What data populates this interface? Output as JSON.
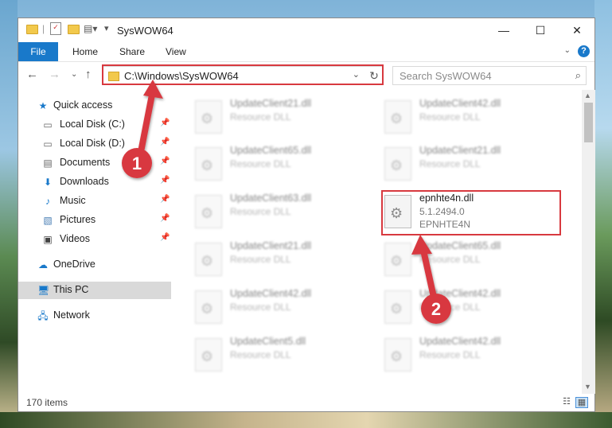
{
  "window": {
    "title": "SysWOW64",
    "controls": {
      "minimize": "—",
      "maximize": "☐",
      "close": "✕"
    }
  },
  "ribbon": {
    "tabs": [
      "File",
      "Home",
      "Share",
      "View"
    ],
    "help": "?"
  },
  "address": {
    "path": "C:\\Windows\\SysWOW64",
    "search_placeholder": "Search SysWOW64"
  },
  "sidebar": {
    "items": [
      {
        "label": "Quick access",
        "icon": "star-icon"
      },
      {
        "label": "Local Disk (C:)",
        "icon": "drive-icon",
        "pinned": true
      },
      {
        "label": "Local Disk (D:)",
        "icon": "drive-icon",
        "pinned": true
      },
      {
        "label": "Documents",
        "icon": "documents-icon",
        "pinned": true
      },
      {
        "label": "Downloads",
        "icon": "download-icon",
        "pinned": true
      },
      {
        "label": "Music",
        "icon": "music-icon",
        "pinned": true
      },
      {
        "label": "Pictures",
        "icon": "pictures-icon",
        "pinned": true
      },
      {
        "label": "Videos",
        "icon": "videos-icon",
        "pinned": true
      },
      {
        "label": "OneDrive",
        "icon": "cloud-icon"
      },
      {
        "label": "This PC",
        "icon": "computer-icon",
        "selected": true
      },
      {
        "label": "Network",
        "icon": "network-icon"
      }
    ]
  },
  "files": [
    {
      "name": "UpdateClient21.dll",
      "type": "Resource DLL"
    },
    {
      "name": "UpdateClient42.dll",
      "type": "Resource DLL"
    },
    {
      "name": "UpdateClient65.dll",
      "type": "Resource DLL"
    },
    {
      "name": "UpdateClient21.dll",
      "type": "Resource DLL"
    },
    {
      "name": "UpdateClient63.dll",
      "type": "Resource DLL"
    },
    {
      "name": "epnhte4n.dll",
      "version": "5.1.2494.0",
      "description": "EPNHTE4N"
    },
    {
      "name": "UpdateClient21.dll",
      "type": "Resource DLL"
    },
    {
      "name": "UpdateClient65.dll",
      "type": "Resource DLL"
    },
    {
      "name": "UpdateClient42.dll",
      "type": "Resource DLL"
    },
    {
      "name": "UpdateClient42.dll",
      "type": "Resource DLL"
    },
    {
      "name": "UpdateClient5.dll",
      "type": "Resource DLL"
    },
    {
      "name": "UpdateClient42.dll",
      "type": "Resource DLL"
    }
  ],
  "status": {
    "item_count": "170 items"
  },
  "annotations": {
    "step1": "1",
    "step2": "2",
    "color": "#d8393f"
  }
}
